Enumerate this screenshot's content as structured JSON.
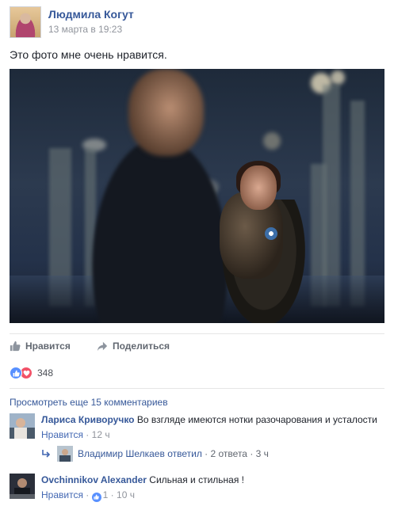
{
  "post": {
    "author": "Людмила Когут",
    "timestamp": "13 марта в 19:23",
    "text": "Это фото мне очень нравится."
  },
  "actions": {
    "like_label": "Нравится",
    "share_label": "Поделиться"
  },
  "reactions": {
    "icons": [
      "like-icon",
      "love-icon"
    ],
    "count": "348"
  },
  "comments_section": {
    "view_more": "Просмотреть еще 15 комментариев",
    "comments": [
      {
        "author": "Лариса Криворучко",
        "text": "Во взгляде имеются нотки разочарования и усталости",
        "like_label": "Нравится",
        "separator": "·",
        "time": "12 ч",
        "reply": {
          "name": "Владимир Шелкаев ответил",
          "separator": "·",
          "count": "2 ответа",
          "separator2": "·",
          "time": "3 ч"
        }
      },
      {
        "author": "Ovchinnikov Alexander",
        "text": "Сильная и стильная !",
        "like_label": "Нравится",
        "separator": "·",
        "likes": "1",
        "separator2": "·",
        "time": "10 ч"
      }
    ]
  },
  "colors": {
    "link": "#365899",
    "meta": "#90949c",
    "like_blue": "#5890ff",
    "love_red": "#f25268"
  }
}
